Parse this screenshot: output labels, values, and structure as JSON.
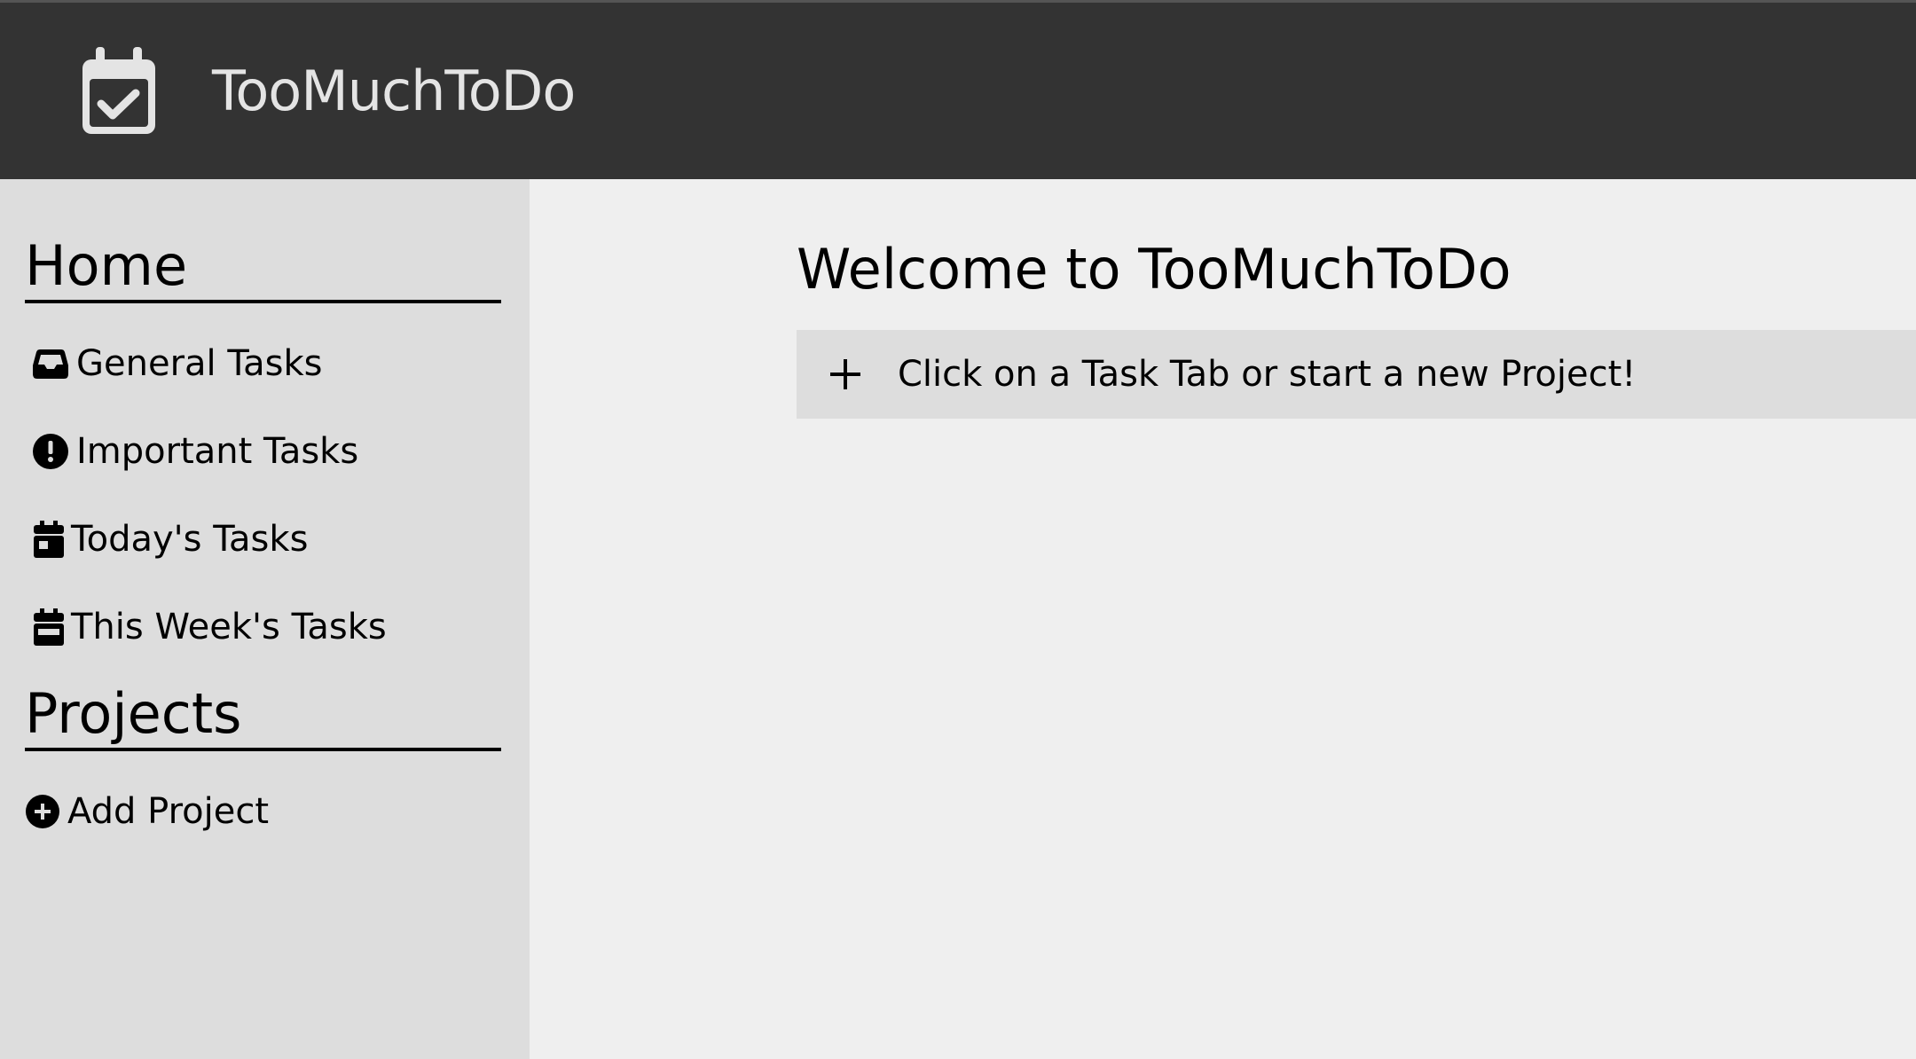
{
  "app": {
    "title": "TooMuchToDo",
    "logo_icon": "calendar-check-icon"
  },
  "sidebar": {
    "home_heading": "Home",
    "items": [
      {
        "label": "General Tasks",
        "icon": "inbox-icon"
      },
      {
        "label": "Important Tasks",
        "icon": "exclamation-circle-icon"
      },
      {
        "label": "Today's Tasks",
        "icon": "calendar-day-icon"
      },
      {
        "label": "This Week's Tasks",
        "icon": "calendar-week-icon"
      }
    ],
    "projects_heading": "Projects",
    "add_project": {
      "label": "Add Project",
      "icon": "plus-circle-icon"
    }
  },
  "main": {
    "heading": "Welcome to TooMuchToDo",
    "banner": {
      "text": "Click on a Task Tab or start a new Project!",
      "icon": "plus-icon"
    }
  },
  "colors": {
    "topbar": "#333333",
    "sidebar": "#dddddd",
    "main_bg": "#efefef",
    "banner": "#dddddd"
  }
}
